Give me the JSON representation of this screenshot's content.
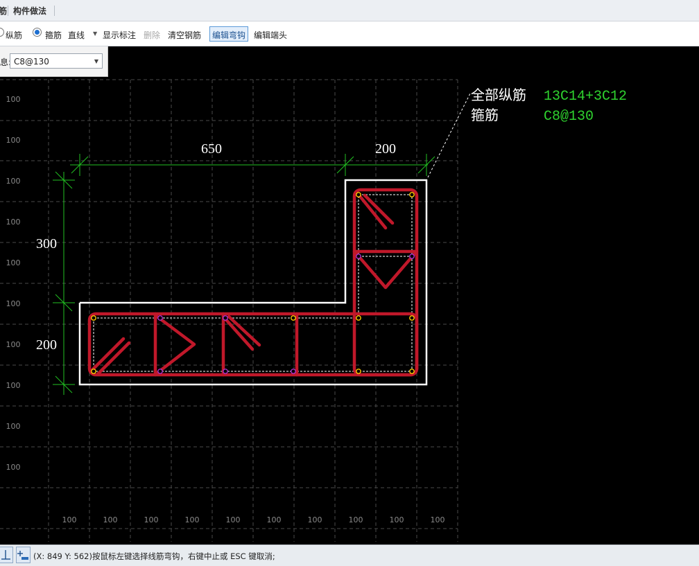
{
  "tabs": [
    {
      "label": "筋"
    },
    {
      "label": "构件做法"
    }
  ],
  "toolbar": {
    "radio_longitudinal": "纵筋",
    "radio_stirrup": "箍筋",
    "line_type": "直线",
    "show_dimension": "显示标注",
    "delete": "删除",
    "clear_rebar": "清空钢筋",
    "edit_hook": "编辑弯钩",
    "edit_end": "编辑端头"
  },
  "stirrup_info": {
    "label": "息:",
    "value": "C8@130"
  },
  "grid": {
    "left_labels": [
      "100",
      "100",
      "100",
      "100",
      "100",
      "100",
      "100",
      "100",
      "100",
      "100"
    ],
    "bottom_labels": [
      "100",
      "100",
      "100",
      "100",
      "100",
      "100",
      "100",
      "100",
      "100",
      "100"
    ]
  },
  "dimensions": {
    "top_left": "650",
    "top_right": "200",
    "left_upper": "300",
    "left_lower": "200"
  },
  "annotation": {
    "longitudinal_label": "全部纵筋",
    "longitudinal_value": "13C14+3C12",
    "stirrup_label": "箍筋",
    "stirrup_value": "C8@130"
  },
  "statusbar": {
    "message": "(X: 849 Y: 562)按鼠标左键选择线筋弯钩，右键中止或 ESC 键取消;"
  },
  "colors": {
    "background": "#000000",
    "outline": "#ffffff",
    "rebar": "#c0182a",
    "dimension": "#22c022",
    "annotation_value": "#2fd22f",
    "grid": "#4a4a4a",
    "point_outer": "#ffcc00",
    "point_inner": "#aa33cc"
  }
}
